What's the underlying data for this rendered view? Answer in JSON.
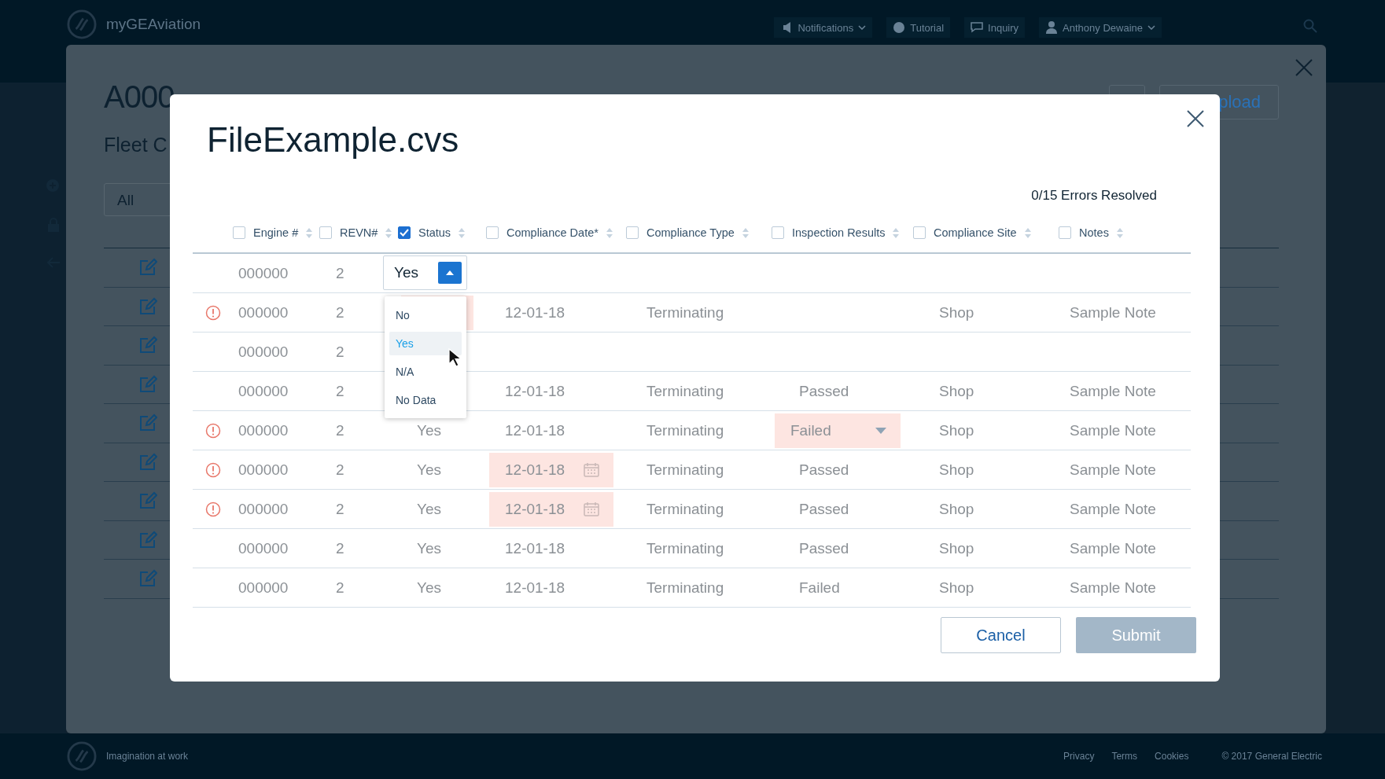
{
  "app_header": {
    "brand": "myGEAviation",
    "nav": [
      {
        "label": "Notifications",
        "dropdown": true
      },
      {
        "label": "Tutorial",
        "dropdown": false
      },
      {
        "label": "Inquiry",
        "dropdown": false
      },
      {
        "label": "Anthony Dewaine",
        "dropdown": true
      }
    ]
  },
  "background_page": {
    "title": "A000",
    "subtitle": "Fleet C",
    "filter": "All",
    "upload_button": "pload"
  },
  "dialog": {
    "title": "FileExample.cvs",
    "errors_resolved": "0/15 Errors Resolved",
    "columns": [
      {
        "label": "Engine #",
        "checked": false
      },
      {
        "label": "REVN#",
        "checked": false
      },
      {
        "label": "Status",
        "checked": true
      },
      {
        "label": "Compliance Date*",
        "checked": false
      },
      {
        "label": "Compliance Type",
        "checked": false
      },
      {
        "label": "Inspection Results",
        "checked": false
      },
      {
        "label": "Compliance Site",
        "checked": false
      },
      {
        "label": "Notes",
        "checked": false
      }
    ],
    "rows": [
      {
        "error": false,
        "cells": [
          {
            "text": "000000"
          },
          {
            "text": "2"
          },
          {
            "kind": "dropdown",
            "value": "Yes",
            "expanded": true,
            "options": [
              {
                "label": "No",
                "selected": false
              },
              {
                "label": "Yes",
                "selected": true
              },
              {
                "label": "N/A",
                "selected": false
              },
              {
                "label": "No Data",
                "selected": false
              }
            ]
          },
          null,
          null,
          null,
          null,
          null
        ]
      },
      {
        "error": true,
        "cells": [
          {
            "text": "000000"
          },
          {
            "text": "2"
          },
          {
            "kind": "text",
            "error": true
          },
          {
            "text": "12-01-18"
          },
          {
            "text": "Terminating"
          },
          null,
          {
            "text": "Shop"
          },
          {
            "text": "Sample Note"
          }
        ]
      },
      {
        "error": false,
        "cells": [
          {
            "text": "000000"
          },
          {
            "text": "2"
          },
          null,
          null,
          null,
          null,
          null,
          null
        ]
      },
      {
        "error": false,
        "cells": [
          {
            "text": "000000"
          },
          {
            "text": "2"
          },
          null,
          {
            "text": "12-01-18"
          },
          {
            "text": "Terminating"
          },
          {
            "text": "Passed"
          },
          {
            "text": "Shop"
          },
          {
            "text": "Sample Note"
          }
        ]
      },
      {
        "error": true,
        "cells": [
          {
            "text": "000000"
          },
          {
            "text": "2"
          },
          {
            "text": "Yes"
          },
          {
            "text": "12-01-18"
          },
          {
            "text": "Terminating"
          },
          {
            "text": "Failed",
            "kind": "select",
            "error": true
          },
          {
            "text": "Shop"
          },
          {
            "text": "Sample Note"
          }
        ]
      },
      {
        "error": true,
        "cells": [
          {
            "text": "000000"
          },
          {
            "text": "2"
          },
          {
            "text": "Yes"
          },
          {
            "text": "12-01-18",
            "kind": "date",
            "error": true
          },
          {
            "text": "Terminating"
          },
          {
            "text": "Passed"
          },
          {
            "text": "Shop"
          },
          {
            "text": "Sample Note"
          }
        ]
      },
      {
        "error": true,
        "cells": [
          {
            "text": "000000"
          },
          {
            "text": "2"
          },
          {
            "text": "Yes"
          },
          {
            "text": "12-01-18",
            "kind": "date",
            "error": true
          },
          {
            "text": "Terminating"
          },
          {
            "text": "Passed"
          },
          {
            "text": "Shop"
          },
          {
            "text": "Sample Note"
          }
        ]
      },
      {
        "error": false,
        "cells": [
          {
            "text": "000000"
          },
          {
            "text": "2"
          },
          {
            "text": "Yes"
          },
          {
            "text": "12-01-18"
          },
          {
            "text": "Terminating"
          },
          {
            "text": "Passed"
          },
          {
            "text": "Shop"
          },
          {
            "text": "Sample Note"
          }
        ]
      },
      {
        "error": false,
        "cells": [
          {
            "text": "000000"
          },
          {
            "text": "2"
          },
          {
            "text": "Yes"
          },
          {
            "text": "12-01-18"
          },
          {
            "text": "Terminating"
          },
          {
            "text": "Failed"
          },
          {
            "text": "Shop"
          },
          {
            "text": "Sample Note"
          }
        ]
      }
    ],
    "buttons": [
      {
        "label": "Cancel",
        "kind": "secondary",
        "disabled": false
      },
      {
        "label": "Submit",
        "kind": "primary",
        "disabled": true
      }
    ]
  },
  "footer": {
    "tagline": "Imagination at work",
    "links": [
      "Privacy",
      "Terms",
      "Cookies"
    ],
    "copyright": "© 2017 General Electric"
  }
}
